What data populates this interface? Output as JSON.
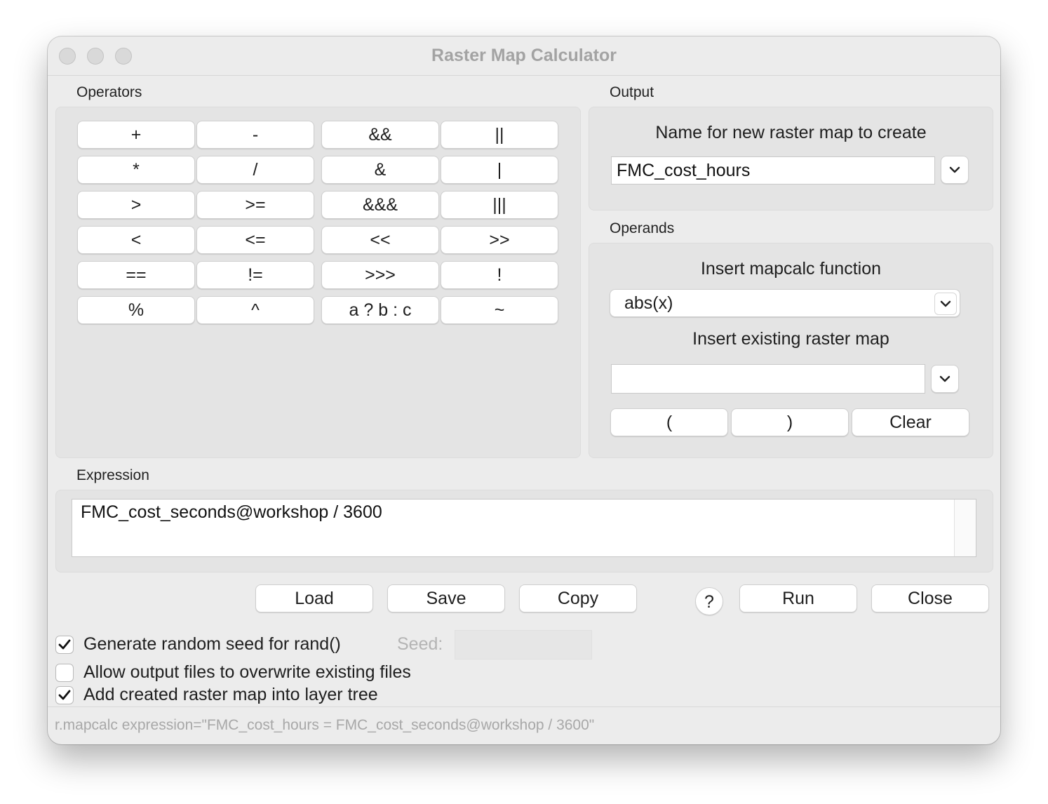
{
  "window": {
    "title": "Raster Map Calculator"
  },
  "operators": {
    "label": "Operators",
    "buttons": [
      "+",
      "-",
      "&&",
      "||",
      "*",
      "/",
      "&",
      "|",
      ">",
      ">=",
      "&&&",
      "|||",
      "<",
      "<=",
      "<<",
      ">>",
      "==",
      "!=",
      ">>>",
      "!",
      "%",
      "^",
      "a ? b : c",
      "~"
    ]
  },
  "output": {
    "label": "Output",
    "name_label": "Name for new raster map to create",
    "name_value": "FMC_cost_hours"
  },
  "operands": {
    "label": "Operands",
    "function_label": "Insert mapcalc function",
    "function_value": "abs(x)",
    "raster_label": "Insert existing raster map",
    "raster_value": "",
    "open_paren": "(",
    "close_paren": ")",
    "clear": "Clear"
  },
  "expression": {
    "label": "Expression",
    "value": "FMC_cost_seconds@workshop / 3600"
  },
  "actions": {
    "load": "Load",
    "save": "Save",
    "copy": "Copy",
    "help": "?",
    "run": "Run",
    "close": "Close"
  },
  "options": {
    "random_seed_label": "Generate random seed for rand()",
    "random_seed_checked": true,
    "seed_label": "Seed:",
    "seed_value": "",
    "overwrite_label": "Allow output files to overwrite existing files",
    "overwrite_checked": false,
    "add_layer_label": "Add created raster map into layer tree",
    "add_layer_checked": true
  },
  "status": {
    "command": "r.mapcalc expression=\"FMC_cost_hours = FMC_cost_seconds@workshop / 3600\""
  }
}
